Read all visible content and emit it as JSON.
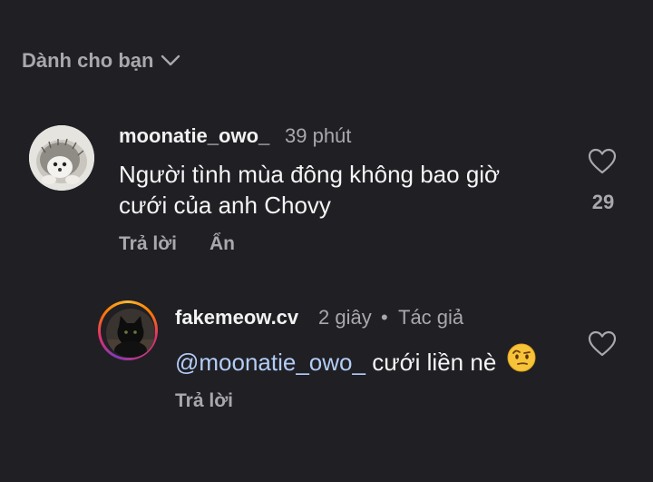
{
  "filter": {
    "label": "Dành cho bạn",
    "icon": "chevron-down-icon"
  },
  "comments": [
    {
      "username": "moonatie_owo_",
      "time": "39 phút",
      "text": "Người tình mùa đông không bao giờ cưới của anh Chovy",
      "reply_label": "Trả lời",
      "hide_label": "Ẩn",
      "like_count": "29",
      "avatar_icon": "hedgehog-avatar"
    }
  ],
  "replies": [
    {
      "username": "fakemeow.cv",
      "time": "2 giây",
      "separator": "•",
      "author_tag": "Tác giả",
      "mention": "@moonatie_owo_",
      "text": "cưới liền nè",
      "emoji": "face-with-raised-eyebrow-emoji",
      "reply_label": "Trả lời",
      "avatar_icon": "black-cat-avatar"
    }
  ],
  "colors": {
    "background": "#1f1f24",
    "secondary_text": "#a8a8ad",
    "mention": "#b3ccf5"
  }
}
